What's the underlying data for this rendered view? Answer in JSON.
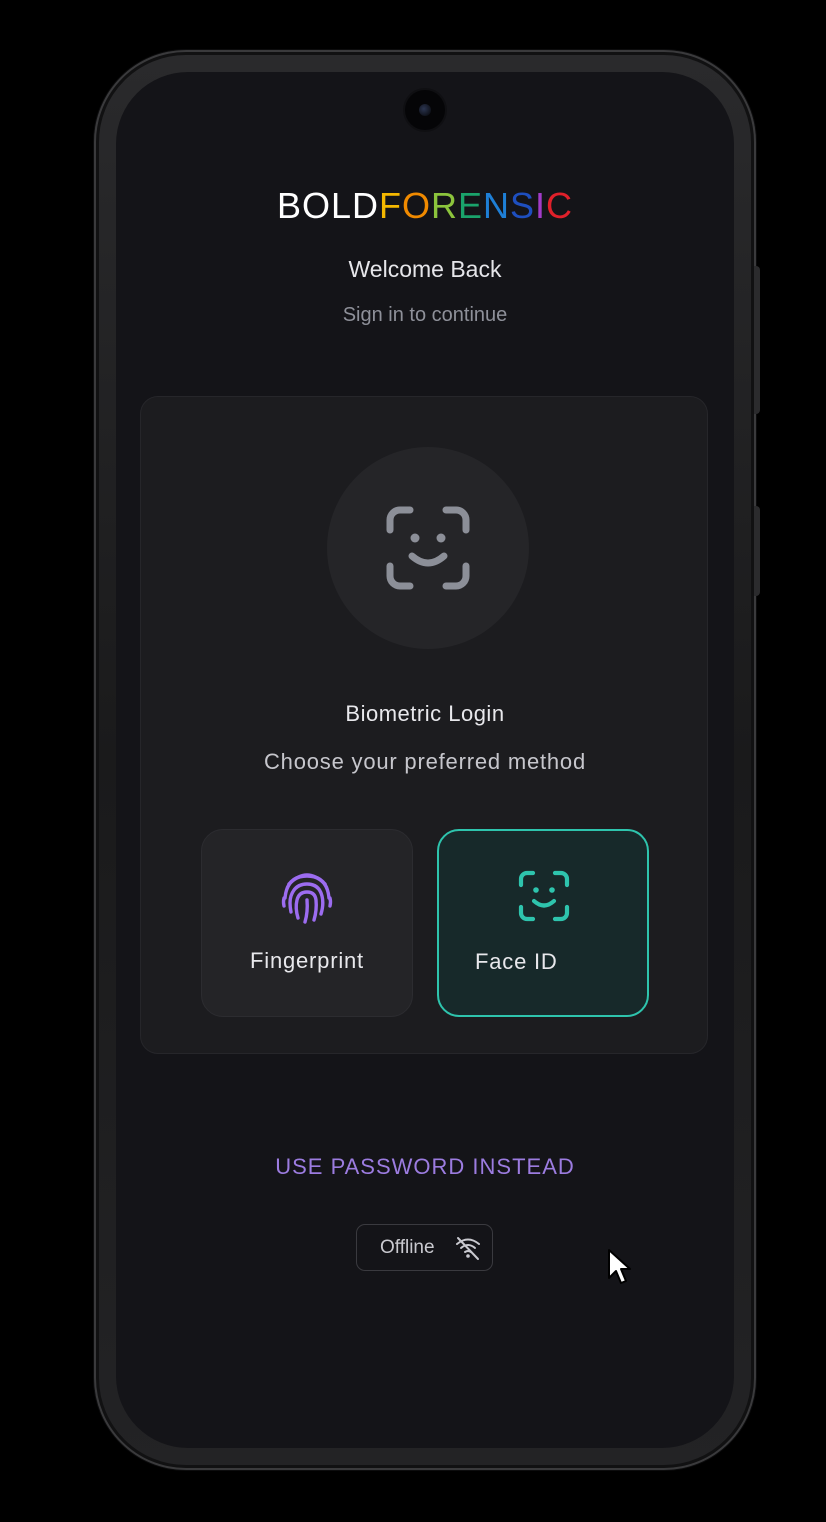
{
  "brand": {
    "part1": "BOLD",
    "part2_letters": [
      "F",
      "O",
      "R",
      "E",
      "N",
      "S",
      "I",
      "C"
    ],
    "part2_colors": [
      "#f5b800",
      "#f08a00",
      "#8cc43c",
      "#1aa36b",
      "#1e7fd6",
      "#1e4fbf",
      "#a23cc8",
      "#e0202a"
    ],
    "part1_color": "#ffffff"
  },
  "header": {
    "title": "Welcome Back",
    "subtitle": "Sign in to continue"
  },
  "biometric_card": {
    "icon": "face-id-icon",
    "title": "Biometric Login",
    "subtitle": "Choose your preferred method",
    "methods": [
      {
        "label": "Fingerprint",
        "icon": "fingerprint-icon",
        "selected": false,
        "accent": "#9c6cf0"
      },
      {
        "label": "Face ID",
        "icon": "face-id-icon",
        "selected": true,
        "accent": "#2ec4ad"
      }
    ]
  },
  "password_link": "USE PASSWORD INSTEAD",
  "status": {
    "label": "Offline",
    "icon": "wifi-off-icon"
  },
  "colors": {
    "background": "#141418",
    "card": "#1c1c1f",
    "accent_purple": "#9c7ce0",
    "accent_teal": "#2ec4ad"
  }
}
